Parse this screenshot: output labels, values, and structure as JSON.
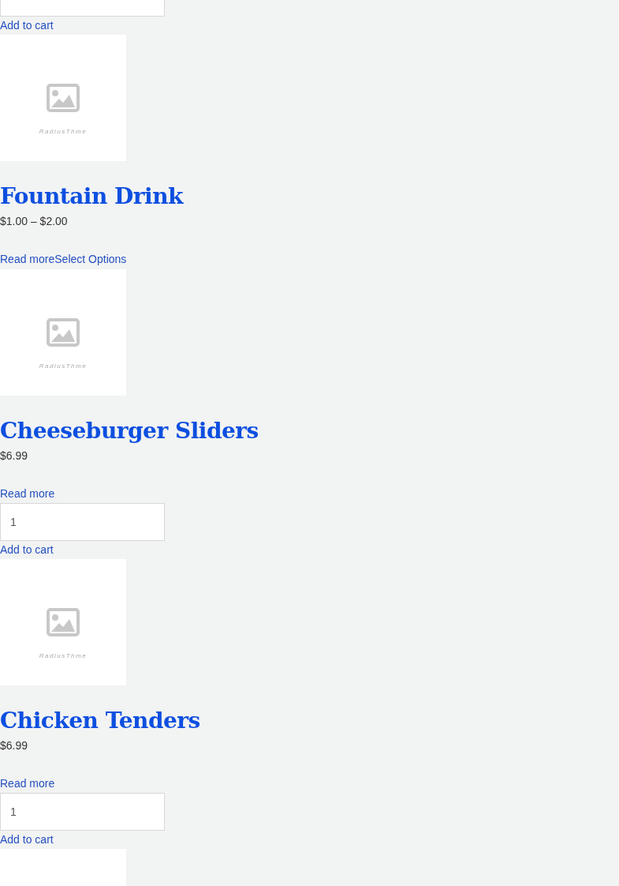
{
  "top_item": {
    "add_to_cart": "Add to cart"
  },
  "products": [
    {
      "kind": "variable",
      "image_caption": "RadiusThme",
      "title": "Fountain Drink",
      "price": "$1.00 – $2.00",
      "links": [
        "Read more",
        "Select Options"
      ]
    },
    {
      "kind": "simple",
      "image_caption": "RadiusThme",
      "title": "Cheeseburger Sliders",
      "price": "$6.99",
      "links": [
        "Read more"
      ],
      "quantity": "1",
      "add_to_cart": "Add to cart"
    },
    {
      "kind": "simple",
      "image_caption": "RadiusThme",
      "title": "Chicken Tenders",
      "price": "$6.99",
      "links": [
        "Read more"
      ],
      "quantity": "1",
      "add_to_cart": "Add to cart"
    },
    {
      "kind": "image_only"
    }
  ]
}
